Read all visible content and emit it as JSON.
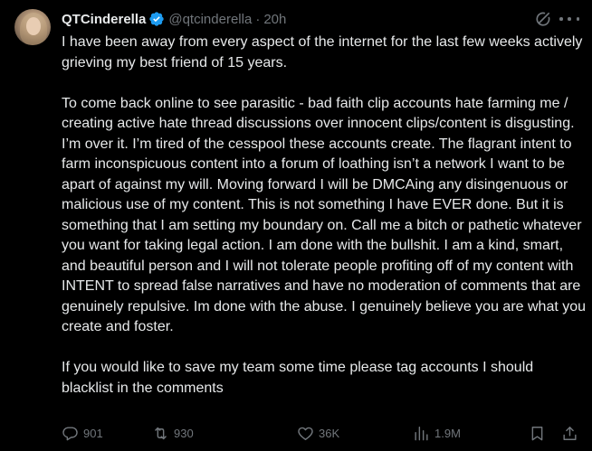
{
  "author": {
    "display_name": "QTCinderella",
    "handle": "@qtcinderella",
    "separator": "·",
    "time": "20h",
    "verified_color": "#1d9bf0"
  },
  "tweet": {
    "paragraphs": [
      "I have been away from every aspect of the internet for the last few weeks actively grieving my best friend of 15 years.",
      "To come back online to see parasitic - bad faith clip accounts hate farming me / creating active hate thread discussions over innocent clips/content is disgusting. I’m over it. I’m tired of the cesspool these accounts create. The flagrant intent to farm inconspicuous content into a forum of loathing isn’t a network I want to be apart of against my will. Moving forward I will be DMCAing any disingenuous or malicious use of my content. This is not something I have EVER done. But it is something that I am setting my boundary on. Call me a bitch or pathetic whatever you want for taking legal action. I am done with the bullshit. I am a kind, smart, and beautiful person and I will not tolerate people profiting off of my content with INTENT to spread false narratives and have no moderation of comments that are genuinely repulsive. Im done with the abuse. I genuinely believe you are what you create and foster.",
      "If you would like to save my team some time  please tag accounts I should blacklist in the comments"
    ]
  },
  "actions": {
    "replies": "901",
    "reposts": "930",
    "likes": "36K",
    "views": "1.9M"
  },
  "icons": {
    "reply": "reply-icon",
    "repost": "repost-icon",
    "like": "heart-icon",
    "views": "analytics-icon",
    "bookmark": "bookmark-icon",
    "share": "share-icon",
    "grok": "grok-icon",
    "more": "more-icon"
  },
  "colors": {
    "background": "#000000",
    "text": "#e7e9ea",
    "muted": "#71767b"
  }
}
